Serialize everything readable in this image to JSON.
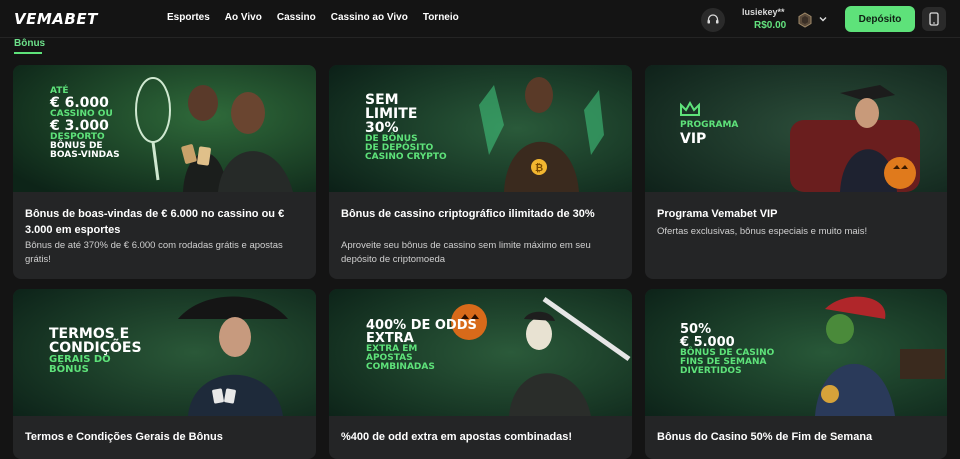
{
  "header": {
    "logo": "VEMABET",
    "nav": [
      "Esportes",
      "Ao Vivo",
      "Cassino",
      "Cassino ao Vivo",
      "Torneio"
    ],
    "username": "lusiekey**",
    "balance": "R$0.00",
    "deposit_label": "Depósito"
  },
  "breadcrumb": "Bônus",
  "cards": [
    {
      "banner_lines": [
        {
          "text": "ATÉ",
          "style": "green"
        },
        {
          "text": "€ 6.000",
          "style": "white"
        },
        {
          "text": "CASSINO OU",
          "style": "green"
        },
        {
          "text": "€ 3.000",
          "style": "white"
        },
        {
          "text": "DESPORTO",
          "style": "green"
        },
        {
          "text": "BÔNUS DE",
          "style": "white"
        },
        {
          "text": "BOAS-VINDAS",
          "style": "white"
        }
      ],
      "title": "Bônus de boas-vindas de € 6.000 no cassino ou € 3.000 em esportes",
      "desc": "Bônus de até 370% de € 6.000 com rodadas grátis e apostas grátis!"
    },
    {
      "banner_lines": [
        {
          "text": "SEM",
          "style": "white"
        },
        {
          "text": "LIMITE",
          "style": "white"
        },
        {
          "text": "30%",
          "style": "white"
        },
        {
          "text": "DE BÔNUS",
          "style": "green"
        },
        {
          "text": "DE DEPÓSITO",
          "style": "green"
        },
        {
          "text": "CASINO CRYPTO",
          "style": "green"
        }
      ],
      "title": "Bônus de cassino criptográfico ilimitado de 30%",
      "desc": "Aproveite seu bônus de cassino sem limite máximo em seu depósito de criptomoeda"
    },
    {
      "banner_lines": [
        {
          "text": "PROGRAMA",
          "style": "green"
        },
        {
          "text": "VIP",
          "style": "white"
        }
      ],
      "title": "Programa Vemabet VIP",
      "desc": "Ofertas exclusivas, bônus especiais e muito mais!"
    },
    {
      "banner_lines": [
        {
          "text": "TERMOS E",
          "style": "white"
        },
        {
          "text": "CONDIÇÕES",
          "style": "white"
        },
        {
          "text": "GERAIS DO",
          "style": "green"
        },
        {
          "text": "BÔNUS",
          "style": "green"
        }
      ],
      "title": "Termos e Condições Gerais de Bônus",
      "desc": ""
    },
    {
      "banner_lines": [
        {
          "text": "400% DE ODDS",
          "style": "white"
        },
        {
          "text": "EXTRA",
          "style": "white"
        },
        {
          "text": "EXTRA EM",
          "style": "green"
        },
        {
          "text": "APOSTAS",
          "style": "green"
        },
        {
          "text": "COMBINADAS",
          "style": "green"
        }
      ],
      "title": "%400 de odd extra em apostas combinadas!",
      "desc": ""
    },
    {
      "banner_lines": [
        {
          "text": "50%",
          "style": "white"
        },
        {
          "text": "€ 5.000",
          "style": "white"
        },
        {
          "text": "BÔNUS DE CASINO",
          "style": "green"
        },
        {
          "text": "FINS DE SEMANA",
          "style": "green"
        },
        {
          "text": "DIVERTIDOS",
          "style": "green"
        }
      ],
      "title": "Bônus do Casino 50% de Fim de Semana",
      "desc": ""
    }
  ],
  "colors": {
    "accent": "#5ee27a",
    "banner_text_green": "#5ee27a",
    "card_bg": "#242526",
    "page_bg": "#141414"
  }
}
